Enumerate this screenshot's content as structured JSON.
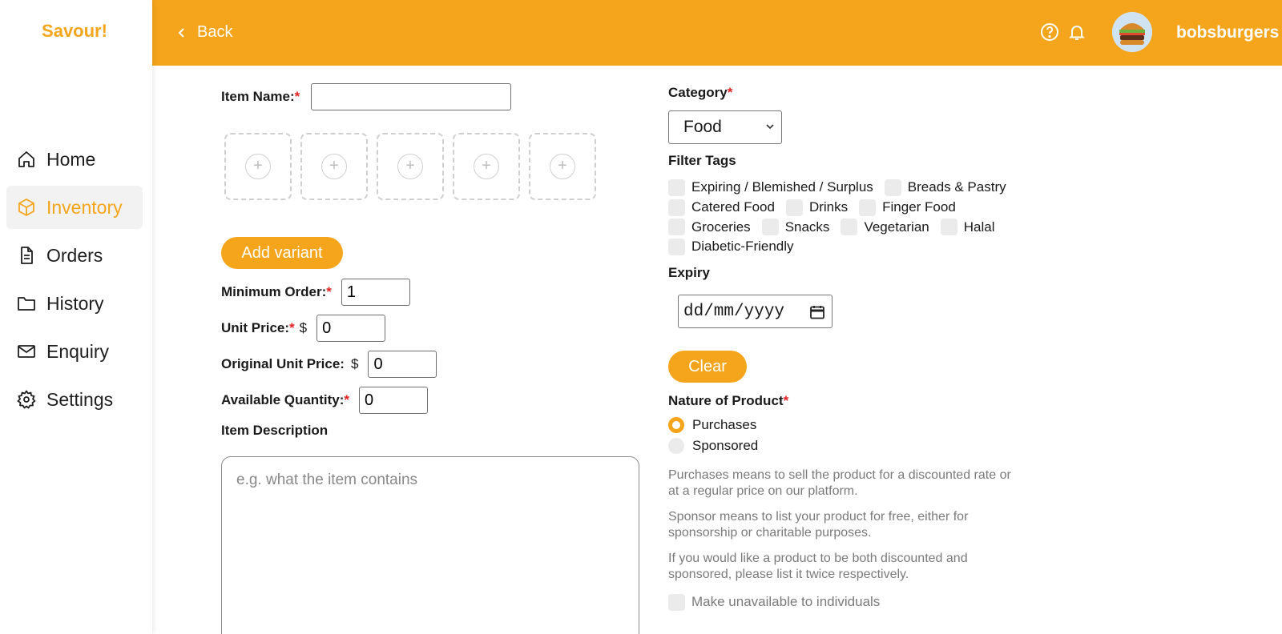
{
  "app": {
    "brand": "Savour!"
  },
  "sidebar": {
    "items": [
      {
        "label": "Home",
        "icon": "home-icon",
        "active": false
      },
      {
        "label": "Inventory",
        "icon": "cube-icon",
        "active": true
      },
      {
        "label": "Orders",
        "icon": "document-icon",
        "active": false
      },
      {
        "label": "History",
        "icon": "folder-icon",
        "active": false
      },
      {
        "label": "Enquiry",
        "icon": "mail-icon",
        "active": false
      },
      {
        "label": "Settings",
        "icon": "gear-icon",
        "active": false
      }
    ]
  },
  "header": {
    "back_label": "Back",
    "username": "bobsburgers",
    "accent_color": "#f5a51c"
  },
  "form": {
    "item_name": {
      "label": "Item Name:",
      "required": "*",
      "value": ""
    },
    "image_slots": 5,
    "add_variant_label": "Add variant",
    "minimum_order": {
      "label": "Minimum Order:",
      "required": "*",
      "value": "1"
    },
    "unit_price": {
      "label": "Unit Price:",
      "required": "*",
      "currency": "$",
      "value": "0"
    },
    "original_unit_price": {
      "label": "Original Unit Price:",
      "currency": "$",
      "value": "0"
    },
    "available_quantity": {
      "label": "Available Quantity:",
      "required": "*",
      "value": "0"
    },
    "item_description": {
      "label": "Item Description",
      "placeholder": "e.g. what the item contains"
    },
    "category": {
      "label": "Category",
      "required": "*",
      "selected": "Food"
    },
    "filter_tags": {
      "label": "Filter Tags",
      "options": [
        "Expiring / Blemished / Surplus",
        "Breads & Pastry",
        "Catered Food",
        "Drinks",
        "Finger Food",
        "Groceries",
        "Snacks",
        "Vegetarian",
        "Halal",
        "Diabetic-Friendly"
      ]
    },
    "expiry": {
      "label": "Expiry",
      "placeholder": "dd/mm/yyyy"
    },
    "clear_label": "Clear",
    "nature": {
      "label": "Nature of Product",
      "required": "*",
      "options": [
        {
          "label": "Purchases",
          "selected": true
        },
        {
          "label": "Sponsored",
          "selected": false
        }
      ]
    },
    "notes": [
      "Purchases means to sell the product for a discounted rate or at a regular price on our platform.",
      "Sponsor means to list your product for free, either for sponsorship or charitable purposes.",
      "If you would like a product to be both discounted and sponsored, please list it twice respectively."
    ],
    "make_unavailable_label": "Make unavailable to individuals"
  }
}
